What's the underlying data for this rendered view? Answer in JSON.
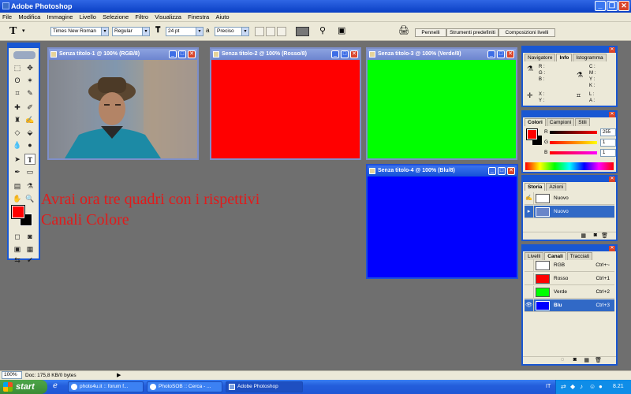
{
  "app": {
    "title": "Adobe Photoshop"
  },
  "menu": [
    "File",
    "Modifica",
    "Immagine",
    "Livello",
    "Selezione",
    "Filtro",
    "Visualizza",
    "Finestra",
    "Aiuto"
  ],
  "options": {
    "tool_glyph": "T",
    "font_family": "Times New Roman",
    "font_style": "Regular",
    "font_size": "24 pt",
    "aa_label": "a",
    "antialias": "Preciso",
    "palette_tabs": [
      "Pennelli",
      "Strumenti predefiniti",
      "Composizioni livelli"
    ]
  },
  "docs": [
    {
      "title": "Senza titolo-1 @ 100% (RGB/8)",
      "color": "#6c86a8"
    },
    {
      "title": "Senza titolo-2 @ 100% (Rosso/8)",
      "color": "#ff0000"
    },
    {
      "title": "Senza titolo-3 @ 100% (Verde/8)",
      "color": "#00ff00"
    },
    {
      "title": "Senza titolo-4 @ 100% (Blu/8)",
      "color": "#0000ff"
    }
  ],
  "instruction": {
    "line1": "Avrai ora tre quadri con i rispettivi",
    "line2": "Canali Colore"
  },
  "info_panel": {
    "tabs": [
      "Navigatore",
      "Info",
      "Istogramma"
    ],
    "rgb": [
      "R :",
      "G :",
      "B :"
    ],
    "cmyk": [
      "C :",
      "M :",
      "Y :",
      "K :"
    ],
    "xy": [
      "X :",
      "Y :"
    ],
    "wh": [
      "L :",
      "A :"
    ]
  },
  "color_panel": {
    "tabs": [
      "Colori",
      "Campioni",
      "Stili"
    ],
    "sliders": [
      {
        "label": "R",
        "value": "255"
      },
      {
        "label": "G",
        "value": "1"
      },
      {
        "label": "B",
        "value": "1"
      }
    ]
  },
  "history_panel": {
    "tabs": [
      "Storia",
      "Azioni"
    ],
    "items": [
      "Nuovo",
      "Nuovo"
    ]
  },
  "channels_panel": {
    "tabs": [
      "Livelli",
      "Canali",
      "Tracciati"
    ],
    "channels": [
      {
        "name": "RGB",
        "shortcut": "Ctrl+~",
        "color": "#ffffff",
        "selected": false
      },
      {
        "name": "Rosso",
        "shortcut": "Ctrl+1",
        "color": "#ff0000",
        "selected": false
      },
      {
        "name": "Verde",
        "shortcut": "Ctrl+2",
        "color": "#00ff00",
        "selected": false
      },
      {
        "name": "Blu",
        "shortcut": "Ctrl+3",
        "color": "#0000ff",
        "selected": true
      }
    ]
  },
  "status": {
    "zoom": "100%",
    "doc": "Doc: 175,8 KB/0 bytes"
  },
  "taskbar": {
    "start": "start",
    "items": [
      "photo4u.it :: forum f...",
      "PhotoSOB :: Cerca - ...",
      "Adobe Photoshop"
    ],
    "lang": "IT",
    "clock": "8.21"
  },
  "colors": {
    "foreground": "#ff0000",
    "background": "#000000",
    "instruction": "#e11b1b"
  }
}
